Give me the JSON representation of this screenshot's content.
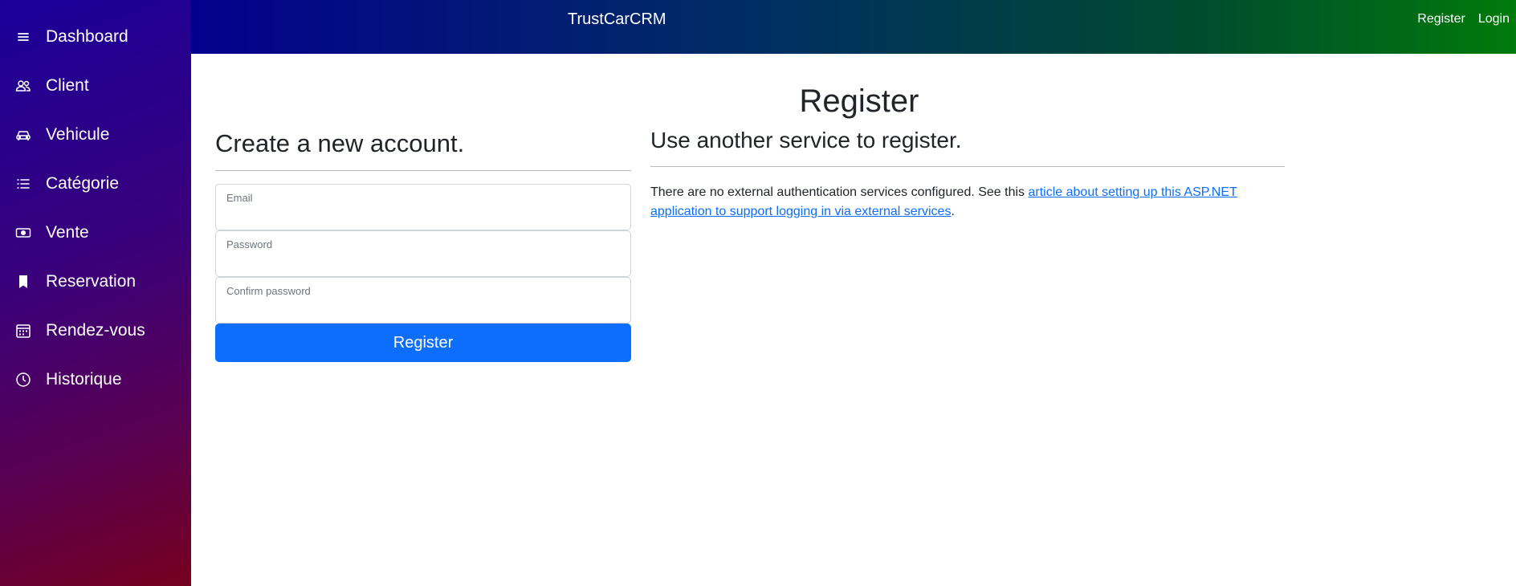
{
  "sidebar": {
    "items": [
      {
        "label": "Dashboard",
        "icon": "menu-icon"
      },
      {
        "label": "Client",
        "icon": "people-icon"
      },
      {
        "label": "Vehicule",
        "icon": "car-icon"
      },
      {
        "label": "Catégorie",
        "icon": "list-icon"
      },
      {
        "label": "Vente",
        "icon": "cash-icon"
      },
      {
        "label": "Reservation",
        "icon": "bookmark-icon"
      },
      {
        "label": "Rendez-vous",
        "icon": "calendar-icon"
      },
      {
        "label": "Historique",
        "icon": "clock-icon"
      }
    ]
  },
  "header": {
    "brand": "TrustCarCRM",
    "links": {
      "register": "Register",
      "login": "Login"
    }
  },
  "main": {
    "title": "Register",
    "form": {
      "heading": "Create a new account.",
      "email_label": "Email",
      "password_label": "Password",
      "confirm_label": "Confirm password",
      "submit_label": "Register"
    },
    "external": {
      "heading": "Use another service to register.",
      "text_before": "There are no external authentication services configured. See this ",
      "link_text": "article about setting up this ASP.NET application to support logging in via external services",
      "text_after": "."
    }
  },
  "colors": {
    "primary": "#0d6efd",
    "sidebar_top": "#1a009a",
    "sidebar_bottom": "#76001f",
    "header_left": "#04008e",
    "header_right": "#007a0a"
  }
}
